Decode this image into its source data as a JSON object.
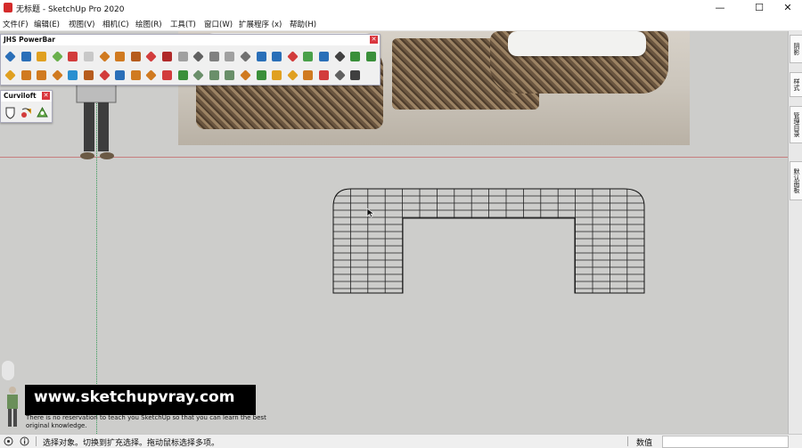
{
  "window": {
    "title": "无标题 - SketchUp Pro 2020",
    "controls": [
      "—",
      "☐",
      "✕"
    ]
  },
  "menubar": {
    "items": [
      "文件(F)",
      "编辑(E)",
      "视图(V)",
      "相机(C)",
      "绘图(R)",
      "工具(T)",
      "窗口(W)",
      "扩展程序 (x)",
      "帮助(H)"
    ]
  },
  "toolbars": {
    "jhs": {
      "title": "JHS PowerBar",
      "row1_colors": [
        "#2a6fb8",
        "#2a6fb8",
        "#e0a020",
        "#6ab04c",
        "#d23c3c",
        "#c8c8c8",
        "#d07a20",
        "#d07a20",
        "#b65c1d",
        "#d23c3c",
        "#b02a2a",
        "#a0a0a0",
        "#606060",
        "#808080",
        "#a0a0a0",
        "#707070",
        "#2a6fb8",
        "#2a6fb8",
        "#d23c3c",
        "#4aa04a",
        "#2a6fb8",
        "#404040",
        "#3a8f3a",
        "#3a8f3a"
      ],
      "row2_colors": [
        "#e0a020",
        "#d07a20",
        "#d07a20",
        "#d07a20",
        "#2a8fd0",
        "#b65c1d",
        "#d23c3c",
        "#2a6fb8",
        "#d07a20",
        "#d07a20",
        "#d23c3c",
        "#3a8f3a",
        "#6a8f6a",
        "#6a8f6a",
        "#6a8f6a",
        "#d07a20",
        "#3a8f3a",
        "#e0a020",
        "#e0a020",
        "#d07a20",
        "#d23c3c",
        "#606060",
        "#404040"
      ]
    },
    "curviloft": {
      "title": "Curviloft",
      "icons": [
        "shield-icon",
        "loft-tool-icon",
        "skin-tool-icon"
      ]
    }
  },
  "side_tabs": [
    "阴影",
    "样式",
    "管理目录",
    "默认面板"
  ],
  "status": {
    "message": "选择对象。切换到扩充选择。拖动鼠标选择多项。",
    "measure_label": "数值",
    "measure_value": ""
  },
  "watermark": {
    "url": "www.sketchupvray.com",
    "caption": "There is no reservation to teach you SketchUp so that you can learn the best original knowledge."
  }
}
